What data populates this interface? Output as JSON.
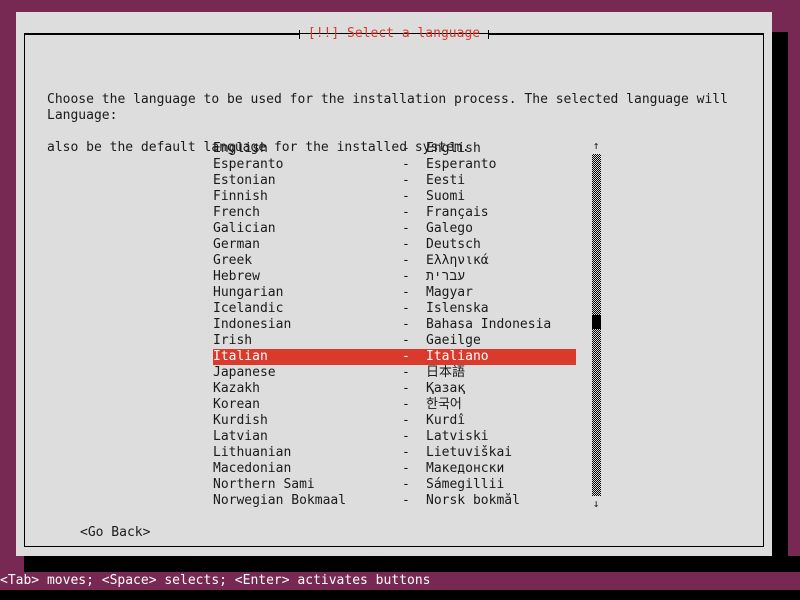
{
  "window": {
    "title": "[!!] Select a language",
    "title_color": "#d93a2b",
    "background_color": "#772953",
    "panel_color": "#dddddd",
    "highlight_color": "#d93a2b"
  },
  "intro": {
    "line1": "Choose the language to be used for the installation process. The selected language will",
    "line2": "also be the default language for the installed system."
  },
  "language_label": "Language:",
  "list": {
    "separator": "-",
    "selected_index": 13,
    "items": [
      {
        "english": "English",
        "native": "English"
      },
      {
        "english": "Esperanto",
        "native": "Esperanto"
      },
      {
        "english": "Estonian",
        "native": "Eesti"
      },
      {
        "english": "Finnish",
        "native": "Suomi"
      },
      {
        "english": "French",
        "native": "Français"
      },
      {
        "english": "Galician",
        "native": "Galego"
      },
      {
        "english": "German",
        "native": "Deutsch"
      },
      {
        "english": "Greek",
        "native": "Ελληνικά"
      },
      {
        "english": "Hebrew",
        "native": "עברית"
      },
      {
        "english": "Hungarian",
        "native": "Magyar"
      },
      {
        "english": "Icelandic",
        "native": "Íslenska"
      },
      {
        "english": "Indonesian",
        "native": "Bahasa Indonesia"
      },
      {
        "english": "Irish",
        "native": "Gaeilge"
      },
      {
        "english": "Italian",
        "native": "Italiano"
      },
      {
        "english": "Japanese",
        "native": "日本語"
      },
      {
        "english": "Kazakh",
        "native": "Қазақ"
      },
      {
        "english": "Korean",
        "native": "한국어"
      },
      {
        "english": "Kurdish",
        "native": "Kurdî"
      },
      {
        "english": "Latvian",
        "native": "Latviski"
      },
      {
        "english": "Lithuanian",
        "native": "Lietuviškai"
      },
      {
        "english": "Macedonian",
        "native": "Македонски"
      },
      {
        "english": "Northern Sami",
        "native": "Sámegillii"
      },
      {
        "english": "Norwegian Bokmaal",
        "native": "Norsk bokmål"
      }
    ]
  },
  "scrollbar": {
    "up_arrow": "↑",
    "down_arrow": "↓",
    "thumb_position_percent": 49
  },
  "buttons": {
    "go_back": "<Go Back>"
  },
  "statusbar": {
    "text": "<Tab> moves; <Space> selects; <Enter> activates buttons"
  }
}
